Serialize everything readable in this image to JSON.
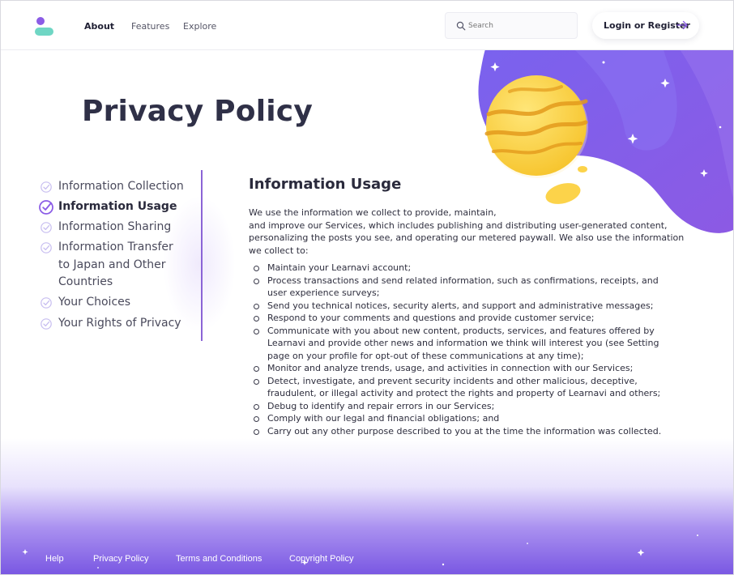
{
  "header": {
    "nav": [
      "About",
      "Features",
      "Explore"
    ],
    "active_nav": "About",
    "search_placeholder": "Search",
    "login_label": "Login or Register"
  },
  "page": {
    "title": "Privacy Policy"
  },
  "sidebar": {
    "items": [
      {
        "label": "Information Collection",
        "active": false
      },
      {
        "label": "Information Usage",
        "active": true
      },
      {
        "label": "Information Sharing",
        "active": false
      },
      {
        "label": "Information Transfer to Japan and Other Countries",
        "active": false
      },
      {
        "label": "Your Choices",
        "active": false
      },
      {
        "label": "Your Rights of Privacy",
        "active": false
      }
    ]
  },
  "section": {
    "heading": "Information Usage",
    "intro_lines": [
      "We use the information we collect to provide, maintain,",
      "and improve our Services, which includes  publishing and distributing user-generated content,",
      "personalizing the posts you see, and operating  our metered paywall. We also use the information",
      "we collect to:"
    ],
    "bullets": [
      "Maintain your Learnavi account;",
      "Process transactions and send related information, such as confirmations, receipts, and user experience surveys;",
      "Send you technical notices, security alerts, and support and administrative messages;",
      "Respond to your comments and questions and provide customer service;",
      "Communicate with you about new content, products, services, and features offered by Learnavi and provide other news and information we think will interest you (see Setting page on your profile for opt-out of these communications at any time);",
      "Monitor and analyze trends, usage, and activities in connection with our Services;",
      "Detect, investigate, and prevent security incidents and other malicious, deceptive, fraudulent, or illegal activity and protect the rights and property of Learnavi and others;",
      "Debug to identify and repair errors in our Services;",
      "Comply with our legal and financial obligations; and",
      "Carry out any other purpose described to you at the time the information was collected."
    ]
  },
  "footer": {
    "links": [
      "Help",
      "Privacy Policy",
      "Terms and Conditions",
      "Copyright Policy"
    ]
  },
  "colors": {
    "accent": "#8b5ce6",
    "logo_teal": "#6fd6c4",
    "planet_yellow": "#fcd64a",
    "footer_purple": "#7856e2"
  },
  "icons": {
    "logo": "learnavi-logo",
    "search": "search-icon",
    "arrow": "arrow-right-icon",
    "check": "check-circle-icon",
    "planet": "planet-illustration"
  }
}
